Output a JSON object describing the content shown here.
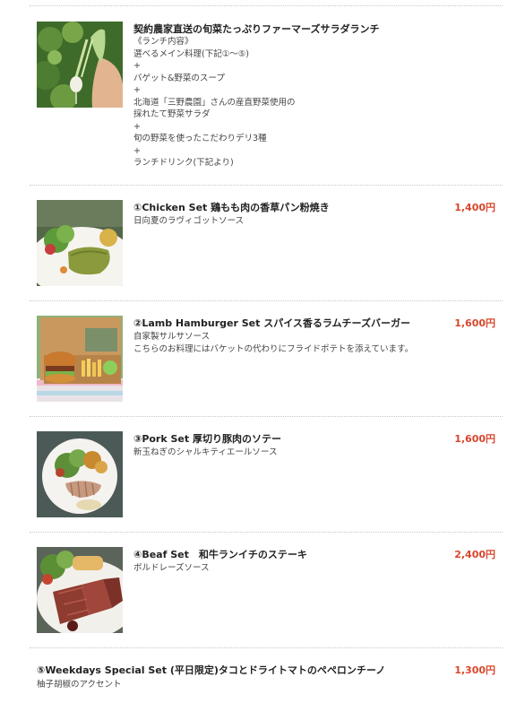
{
  "menu": {
    "items": [
      {
        "title": "契約農家直送の旬菜たっぷりファーマーズサラダランチ",
        "price": "",
        "lines": [
          "《ランチ内容》",
          "選べるメイン料理(下記①〜⑤)",
          "+",
          "バゲット&野菜のスープ",
          "+",
          "北海道「三野農園」さんの産直野菜使用の",
          "採れたて野菜サラダ",
          "+",
          "旬の野菜を使ったこだわりデリ3種",
          "+",
          "ランチドリンク(下記より)"
        ],
        "image": "radish-harvest-photo"
      },
      {
        "title": "①Chicken Set 鶏もも肉の香草パン粉焼き",
        "price": "1,400円",
        "lines": [
          "日向夏のラヴィゴットソース"
        ],
        "image": "chicken-plate-photo"
      },
      {
        "title": "②Lamb Hamburger Set スパイス香るラムチーズバーガー",
        "price": "1,600円",
        "lines": [
          "自家製サルサソース",
          "こちらのお料理にはバケットの代わりにフライドポテトを添えています。"
        ],
        "image": "burger-box-photo"
      },
      {
        "title": "③Pork Set 厚切り豚肉のソテー",
        "price": "1,600円",
        "lines": [
          "新玉ねぎのシャルキティエールソース"
        ],
        "image": "pork-plate-photo"
      },
      {
        "title": "④Beaf Set　和牛ランイチのステーキ",
        "price": "2,400円",
        "lines": [
          "ボルドレーズソース"
        ],
        "image": "steak-plate-photo"
      },
      {
        "title": "⑤Weekdays Special Set (平日限定)タコとドライトマトのペペロンチーノ",
        "price": "1,300円",
        "lines": [
          "柚子胡椒のアクセント"
        ],
        "image": ""
      }
    ]
  }
}
